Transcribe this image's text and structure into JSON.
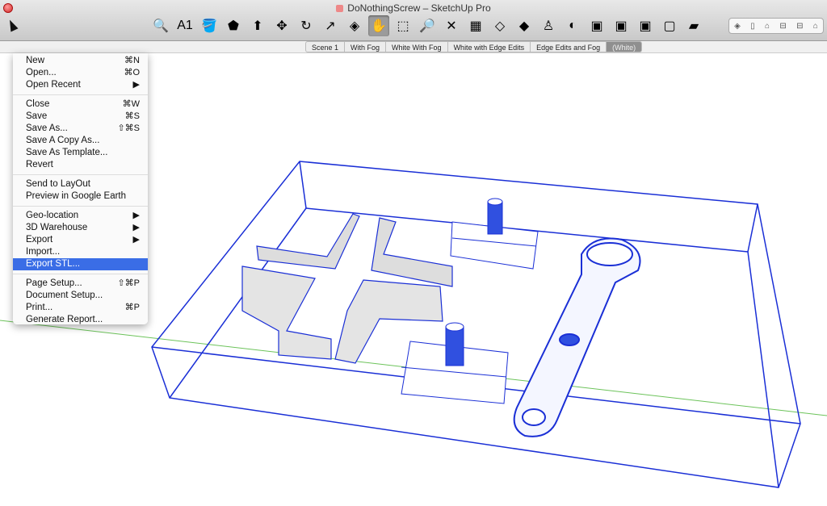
{
  "window": {
    "title": "DoNothingScrew – SketchUp Pro"
  },
  "toolbar": {
    "tools": [
      {
        "name": "tape-measure-icon",
        "glyph": "🔍"
      },
      {
        "name": "text-label-icon",
        "glyph": "A1"
      },
      {
        "name": "paint-bucket-icon",
        "glyph": "🪣"
      },
      {
        "name": "polygon-icon",
        "glyph": "⬟"
      },
      {
        "name": "push-pull-icon",
        "glyph": "⬆"
      },
      {
        "name": "move-icon",
        "glyph": "✥"
      },
      {
        "name": "rotate-icon",
        "glyph": "↻"
      },
      {
        "name": "follow-me-icon",
        "glyph": "↗"
      },
      {
        "name": "offset-icon",
        "glyph": "◈"
      },
      {
        "name": "pan-hand-icon",
        "glyph": "✋"
      },
      {
        "name": "zoom-window-icon",
        "glyph": "⬚"
      },
      {
        "name": "zoom-icon",
        "glyph": "🔎"
      },
      {
        "name": "zoom-extents-icon",
        "glyph": "✕"
      },
      {
        "name": "map-icon",
        "glyph": "▦"
      },
      {
        "name": "terrain-icon",
        "glyph": "◇"
      },
      {
        "name": "google-earth-icon",
        "glyph": "◆"
      },
      {
        "name": "street-view-icon",
        "glyph": "♙"
      },
      {
        "name": "get-models-icon",
        "glyph": "◐"
      },
      {
        "name": "share-model-icon",
        "glyph": "▣"
      },
      {
        "name": "share-component-icon",
        "glyph": "▣"
      },
      {
        "name": "3d-warehouse-icon",
        "glyph": "▣"
      },
      {
        "name": "dynamic-components-icon",
        "glyph": "▢"
      },
      {
        "name": "eraser-icon",
        "glyph": "▰"
      }
    ],
    "views": [
      {
        "name": "iso-view-icon",
        "glyph": "◈"
      },
      {
        "name": "top-view-icon",
        "glyph": "▯"
      },
      {
        "name": "front-view-icon",
        "glyph": "⌂"
      },
      {
        "name": "right-view-icon",
        "glyph": "⊟"
      },
      {
        "name": "back-view-icon",
        "glyph": "⊟"
      },
      {
        "name": "left-view-icon",
        "glyph": "⌂"
      }
    ]
  },
  "scenes": [
    "Scene 1",
    "With Fog",
    "White With Fog",
    "White with Edge Edits",
    "Edge Edits and Fog",
    "(White)"
  ],
  "menu": {
    "groups": [
      [
        {
          "label": "New",
          "shortcut": "⌘N"
        },
        {
          "label": "Open...",
          "shortcut": "⌘O"
        },
        {
          "label": "Open Recent",
          "shortcut": "▶"
        }
      ],
      [
        {
          "label": "Close",
          "shortcut": "⌘W"
        },
        {
          "label": "Save",
          "shortcut": "⌘S"
        },
        {
          "label": "Save As...",
          "shortcut": "⇧⌘S"
        },
        {
          "label": "Save A Copy As...",
          "shortcut": ""
        },
        {
          "label": "Save As Template...",
          "shortcut": ""
        },
        {
          "label": "Revert",
          "shortcut": ""
        }
      ],
      [
        {
          "label": "Send to LayOut",
          "shortcut": ""
        },
        {
          "label": "Preview in Google Earth",
          "shortcut": ""
        }
      ],
      [
        {
          "label": "Geo-location",
          "shortcut": "▶"
        },
        {
          "label": "3D Warehouse",
          "shortcut": "▶"
        },
        {
          "label": "Export",
          "shortcut": "▶"
        },
        {
          "label": "Import...",
          "shortcut": ""
        },
        {
          "label": "Export STL...",
          "shortcut": "",
          "highlighted": true
        }
      ],
      [
        {
          "label": "Page Setup...",
          "shortcut": "⇧⌘P"
        },
        {
          "label": "Document Setup...",
          "shortcut": ""
        },
        {
          "label": "Print...",
          "shortcut": "⌘P"
        },
        {
          "label": "Generate Report...",
          "shortcut": ""
        }
      ]
    ]
  },
  "colors": {
    "edge": "#1a2fd6",
    "axis_green": "#6cc35a",
    "highlight": "#3a6de6"
  }
}
